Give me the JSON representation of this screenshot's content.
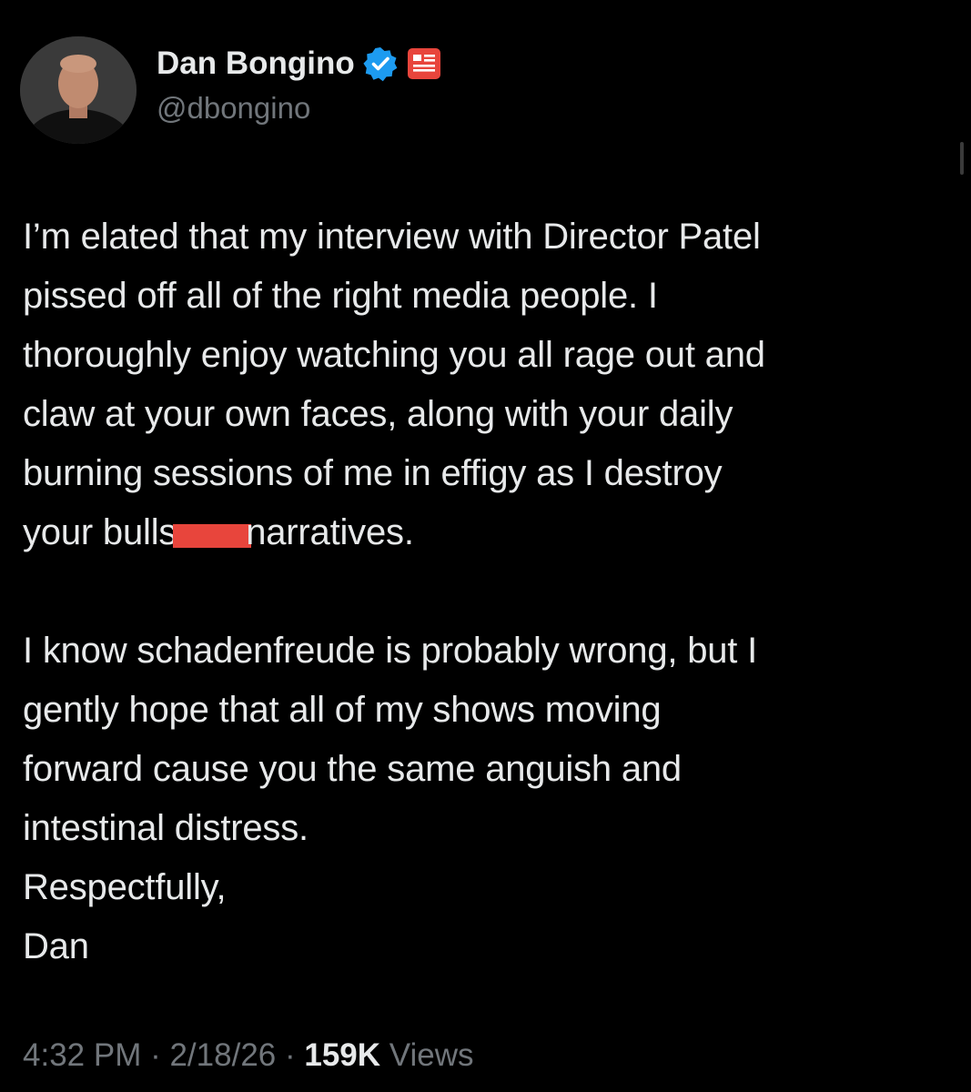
{
  "author": {
    "display_name": "Dan Bongino",
    "handle": "@dbongino",
    "verified": true,
    "verified_color": "#1d9bf0",
    "affiliation_badge_color": "#e8453c"
  },
  "tweet": {
    "para1_start": "I’m elated that my interview with Director Patel\npissed off all of the right media people. I\nthoroughly enjoy watching you all rage out and\nclaw at your own faces, along with your daily\nburning sessions of me in effigy as I destroy\nyour bulls",
    "para1_end": "narratives.",
    "para2": "I know schadenfreude is probably wrong, but I\ngently hope that all of my shows moving\nforward cause you the same anguish and\nintestinal distress.",
    "closing": "Respectfully,",
    "signature": "Dan"
  },
  "meta": {
    "time": "4:32 PM",
    "separator": " · ",
    "date": "2/18/26",
    "views_count": "159K",
    "views_label": " Views"
  },
  "colors": {
    "background": "#000000",
    "text": "#e7e9ea",
    "secondary_text": "#71767b",
    "redaction": "#e8453c"
  }
}
